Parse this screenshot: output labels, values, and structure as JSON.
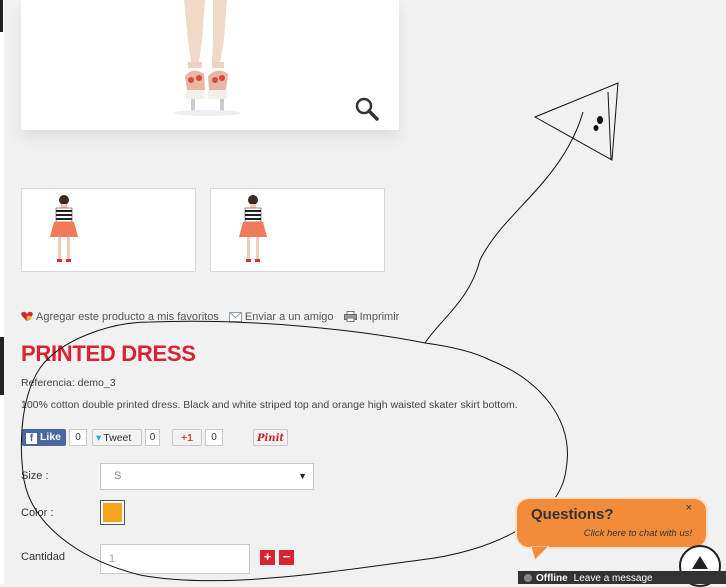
{
  "product": {
    "title": "PRINTED DRESS",
    "reference": "Referencia: demo_3",
    "description": "100% cotton double printed dress. Black and white striped top and orange high waisted skater skirt bottom."
  },
  "actions": {
    "favorite": "Agregar este producto a mis favoritos",
    "send_friend": "Enviar a un amigo",
    "print": "Imprimir"
  },
  "social": {
    "facebook_label": "Like",
    "facebook_count": "0",
    "twitter_label": "Tweet",
    "twitter_count": "0",
    "gplus_label": "+1",
    "gplus_count": "0",
    "pinterest_label": "Pinit"
  },
  "options": {
    "size_label": "Size :",
    "size_value": "S",
    "color_label": "Color :",
    "color_value": "#f5a51b",
    "qty_label": "Cantidad",
    "qty_value": "1",
    "plus_label": "+",
    "minus_label": "−"
  },
  "chat": {
    "title": "Questions?",
    "subtitle": "Click here to chat with us!",
    "close": "×",
    "offline_status": "Offline",
    "offline_message": "Leave a message"
  },
  "colors": {
    "title_red": "#d9242f",
    "button_red": "#d9242f",
    "chat_orange": "#f28b3a",
    "facebook_blue": "#4a66a0"
  },
  "icons": [
    "zoom-icon",
    "heart-icon",
    "mail-icon",
    "printer-icon",
    "chevron-down-icon",
    "arrow-up-icon"
  ]
}
